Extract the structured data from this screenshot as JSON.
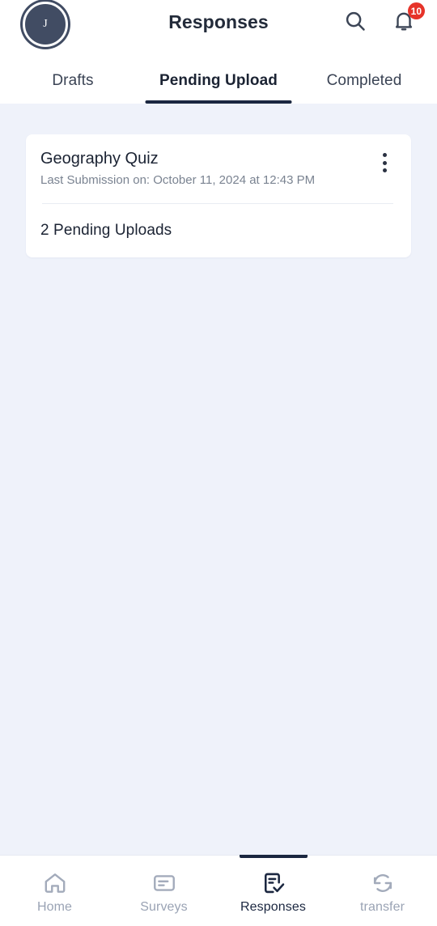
{
  "header": {
    "title": "Responses",
    "avatar_initial": "J",
    "search_icon": "search-icon",
    "notification_icon": "bell-icon",
    "notification_count": "10",
    "accent_color": "#1b2740",
    "badge_color": "#e63329",
    "avatar_color": "#414c63"
  },
  "tabs": [
    {
      "label": "Drafts",
      "active": false
    },
    {
      "label": "Pending Upload",
      "active": true
    },
    {
      "label": "Completed",
      "active": false
    }
  ],
  "main": {
    "background_color": "#eff2fa",
    "cards": [
      {
        "title": "Geography Quiz",
        "subtitle": "Last Submission on: October 11, 2024 at 12:43 PM",
        "footer": "2 Pending Uploads",
        "menu_icon": "kebab-menu-icon"
      }
    ]
  },
  "bottom_nav": [
    {
      "label": "Home",
      "icon": "home-icon",
      "active": false
    },
    {
      "label": "Surveys",
      "icon": "document-lines-icon",
      "active": false
    },
    {
      "label": "Responses",
      "icon": "document-check-icon",
      "active": true
    },
    {
      "label": "transfer",
      "icon": "sync-arrows-icon",
      "active": false
    }
  ]
}
